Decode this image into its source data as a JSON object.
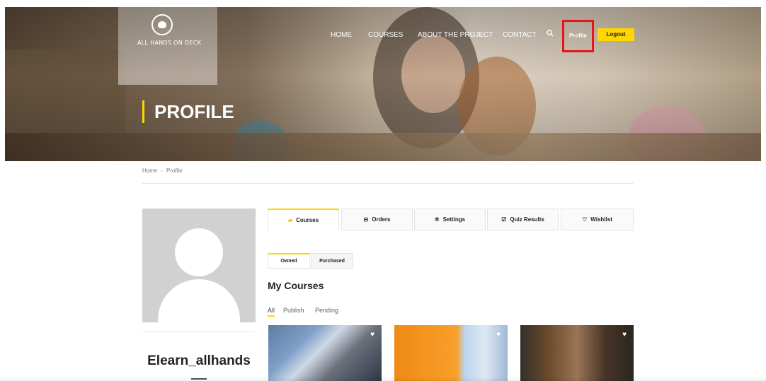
{
  "brand": {
    "name": "ALL HANDS ON DECK"
  },
  "nav": {
    "items": [
      "HOME",
      "COURSES",
      "ABOUT THE PROJECT",
      "CONTACT"
    ],
    "search_icon": "search-icon",
    "profile_label": "Profile",
    "logout_label": "Logout"
  },
  "hero": {
    "title": "PROFILE"
  },
  "breadcrumb": {
    "items": [
      "Home",
      "Profile"
    ]
  },
  "user": {
    "username": "Elearn_allhands"
  },
  "tabs": [
    {
      "label": "Courses",
      "icon": "book-icon",
      "active": true
    },
    {
      "label": "Orders",
      "icon": "cart-icon",
      "active": false
    },
    {
      "label": "Settings",
      "icon": "gear-icon",
      "active": false
    },
    {
      "label": "Quiz Results",
      "icon": "checkbox-icon",
      "active": false
    },
    {
      "label": "Wishlist",
      "icon": "heart-icon",
      "active": false
    }
  ],
  "subtabs": [
    {
      "label": "Owned",
      "active": true
    },
    {
      "label": "Purchased",
      "active": false
    }
  ],
  "courses": {
    "title": "My Courses",
    "filters": [
      "All",
      "Publish",
      "Pending"
    ],
    "active_filter": "All",
    "cards": [
      {
        "icon": "heart-icon"
      },
      {
        "icon": "heart-icon"
      },
      {
        "icon": "heart-icon"
      }
    ]
  },
  "colors": {
    "accent": "#ffd600",
    "highlight_box": "#e8141a"
  }
}
